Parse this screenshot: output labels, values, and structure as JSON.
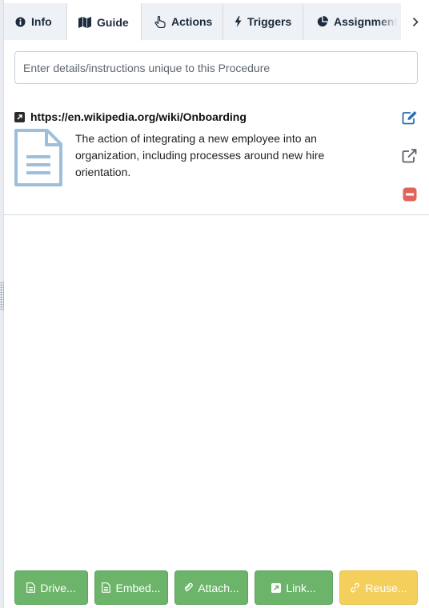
{
  "tabs": [
    {
      "id": "info",
      "label": "Info",
      "icon": "info-icon",
      "active": false
    },
    {
      "id": "guide",
      "label": "Guide",
      "icon": "map-icon",
      "active": true
    },
    {
      "id": "actions",
      "label": "Actions",
      "icon": "pointer-hand-icon",
      "active": false
    },
    {
      "id": "triggers",
      "label": "Triggers",
      "icon": "bolt-icon",
      "active": false
    },
    {
      "id": "assignments",
      "label": "Assignment",
      "icon": "pie-chart-icon",
      "active": false
    }
  ],
  "tab_next_icon": "chevron-right-icon",
  "instructions": {
    "placeholder": "Enter details/instructions unique to this Procedure",
    "value": ""
  },
  "guide_item": {
    "link_icon": "external-link-square-icon",
    "url": "https://en.wikipedia.org/wiki/Onboarding",
    "thumbnail_icon": "document-icon",
    "description": "The action of integrating a new employee into an organization, including processes around new hire orientation.",
    "actions": [
      {
        "name": "edit",
        "icon": "edit-icon",
        "color": "#2a6fb5"
      },
      {
        "name": "open",
        "icon": "external-link-icon",
        "color": "#5a5f66"
      },
      {
        "name": "remove",
        "icon": "minus-square-icon",
        "color": "#e0645a"
      }
    ]
  },
  "bottom_buttons": [
    {
      "name": "drive",
      "label": "Drive...",
      "icon": "file-icon",
      "color": "#6cb46a"
    },
    {
      "name": "embed",
      "label": "Embed...",
      "icon": "file-icon",
      "color": "#6cb46a"
    },
    {
      "name": "attach",
      "label": "Attach...",
      "icon": "paperclip-icon",
      "color": "#6cb46a"
    },
    {
      "name": "link",
      "label": "Link...",
      "icon": "external-link-square-icon",
      "color": "#6cb46a"
    },
    {
      "name": "reuse",
      "label": "Reuse...",
      "icon": "link-chain-icon",
      "color": "#f5cf5c"
    }
  ]
}
